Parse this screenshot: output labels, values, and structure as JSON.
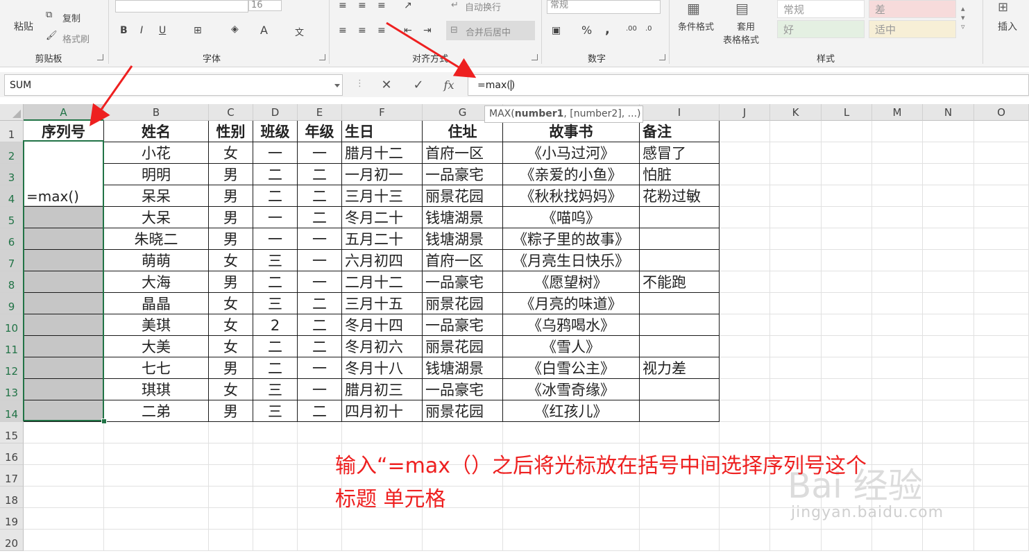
{
  "ribbon": {
    "clipboard": {
      "paste": "粘贴",
      "copy": "复制",
      "format_painter": "格式刷",
      "group": "剪贴板"
    },
    "font": {
      "size": "16",
      "bold": "B",
      "italic": "I",
      "underline": "U",
      "font_color_glyph": "A",
      "group": "字体"
    },
    "alignment": {
      "wrap": "自动换行",
      "merge": "合并后居中",
      "group": "对齐方式"
    },
    "number": {
      "format": "常规",
      "percent": "%",
      "comma": ",",
      "group": "数字"
    },
    "styles": {
      "conditional": "条件格式",
      "table_line1": "套用",
      "table_line2": "表格格式",
      "cell_normal": "常规",
      "cell_bad": "差",
      "cell_good": "好",
      "cell_neutral": "适中",
      "group": "样式"
    },
    "insert": "插入"
  },
  "formula_bar": {
    "name_box": "SUM",
    "cancel": "✕",
    "enter": "✓",
    "fx": "fx",
    "formula_before": "=max(",
    "formula_after": ")",
    "tooltip_fn": "MAX(",
    "tooltip_arg1": "number1",
    "tooltip_rest": ", [number2], ...)"
  },
  "columns": [
    "A",
    "B",
    "C",
    "D",
    "E",
    "F",
    "G",
    "H",
    "I",
    "J",
    "K",
    "L",
    "M",
    "N",
    "O"
  ],
  "rows": [
    "1",
    "2",
    "3",
    "4",
    "5",
    "6",
    "7",
    "8",
    "9",
    "10",
    "11",
    "12",
    "13",
    "14",
    "15",
    "16",
    "17",
    "18",
    "19",
    "20"
  ],
  "table": {
    "headers": [
      "序列号",
      "姓名",
      "性别",
      "班级",
      "年级",
      "生日",
      "住址",
      "故事书",
      "备注"
    ],
    "active_cell_value": "=max()",
    "data": [
      [
        "小花",
        "女",
        "一",
        "一",
        "腊月十二",
        "首府一区",
        "《小马过河》",
        "感冒了"
      ],
      [
        "明明",
        "男",
        "二",
        "二",
        "一月初一",
        "一品豪宅",
        "《亲爱的小鱼》",
        "怕脏"
      ],
      [
        "呆呆",
        "男",
        "二",
        "二",
        "三月十三",
        "丽景花园",
        "《秋秋找妈妈》",
        "花粉过敏"
      ],
      [
        "大呆",
        "男",
        "一",
        "二",
        "冬月二十",
        "钱塘湖景",
        "《喵呜》",
        ""
      ],
      [
        "朱晓二",
        "男",
        "一",
        "一",
        "五月二十",
        "钱塘湖景",
        "《粽子里的故事》",
        ""
      ],
      [
        "萌萌",
        "女",
        "三",
        "一",
        "六月初四",
        "首府一区",
        "《月亮生日快乐》",
        ""
      ],
      [
        "大海",
        "男",
        "二",
        "一",
        "二月十二",
        "一品豪宅",
        "《愿望树》",
        "不能跑"
      ],
      [
        "晶晶",
        "女",
        "三",
        "二",
        "三月十五",
        "丽景花园",
        "《月亮的味道》",
        ""
      ],
      [
        "美琪",
        "女",
        "2",
        "二",
        "冬月十四",
        "一品豪宅",
        "《乌鸦喝水》",
        ""
      ],
      [
        "大美",
        "女",
        "二",
        "二",
        "冬月初六",
        "丽景花园",
        "《雪人》",
        ""
      ],
      [
        "七七",
        "男",
        "二",
        "一",
        "冬月十八",
        "钱塘湖景",
        "《白雪公主》",
        "视力差"
      ],
      [
        "琪琪",
        "女",
        "三",
        "一",
        "腊月初三",
        "一品豪宅",
        "《冰雪奇缘》",
        ""
      ],
      [
        "二弟",
        "男",
        "三",
        "二",
        "四月初十",
        "丽景花园",
        "《红孩儿》",
        ""
      ]
    ]
  },
  "annotation": {
    "line1": "输入“=max（）之后将光标放在括号中间选择序列号这个",
    "line2": "标题 单元格"
  },
  "watermark": {
    "main": "Bai 经验",
    "sub": "jingyan.baidu.com"
  },
  "colors": {
    "accent": "#217346",
    "annotation": "#ee2020",
    "selection": "#c6c6c6"
  }
}
